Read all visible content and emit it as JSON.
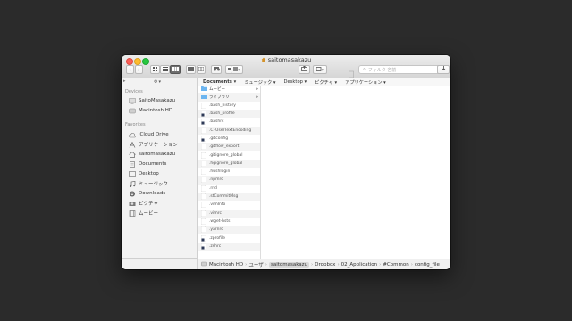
{
  "window": {
    "title": "saitomasakazu"
  },
  "toolbar": {
    "search_placeholder": "フィルタ 名前",
    "back_icon": "chevron-left-icon",
    "forward_icon": "chevron-right-icon"
  },
  "sidebar": {
    "devices_label": "Devices",
    "devices": [
      {
        "label": "SaitoMasakazu",
        "icon": "computer-icon"
      },
      {
        "label": "Macintosh HD",
        "icon": "disk-icon"
      }
    ],
    "favorites_label": "Favorites",
    "favorites": [
      {
        "label": "iCloud Drive",
        "icon": "cloud-icon"
      },
      {
        "label": "アプリケーション",
        "icon": "applications-icon"
      },
      {
        "label": "saitomasakazu",
        "icon": "home-icon"
      },
      {
        "label": "Documents",
        "icon": "documents-icon"
      },
      {
        "label": "Desktop",
        "icon": "desktop-icon"
      },
      {
        "label": "ミュージック",
        "icon": "music-icon"
      },
      {
        "label": "Downloads",
        "icon": "downloads-icon"
      },
      {
        "label": "ピクチャ",
        "icon": "pictures-icon"
      },
      {
        "label": "ムービー",
        "icon": "movies-icon"
      }
    ]
  },
  "column_header": [
    "Documents ▾",
    "ミュージック ▾",
    "Desktop ▾",
    "ピクチャ ▾",
    "アプリケーション ▾"
  ],
  "column1": [
    {
      "label": "ムービー",
      "type": "folder"
    },
    {
      "label": "ライブラリ",
      "type": "folder"
    },
    {
      "label": ".bash_history",
      "type": "file"
    },
    {
      "label": ".bash_profile",
      "type": "exec"
    },
    {
      "label": ".bashrc",
      "type": "exec"
    },
    {
      "label": ".CFUserTextEncoding",
      "type": "file"
    },
    {
      "label": ".gitconfig",
      "type": "exec"
    },
    {
      "label": ".gitflow_export",
      "type": "file"
    },
    {
      "label": ".gitignore_global",
      "type": "file"
    },
    {
      "label": ".hgignore_global",
      "type": "file"
    },
    {
      "label": ".hushlogin",
      "type": "file"
    },
    {
      "label": ".npmrc",
      "type": "file"
    },
    {
      "label": ".rnd",
      "type": "file"
    },
    {
      "label": ".stCommitMsg",
      "type": "file"
    },
    {
      "label": ".vimInfo",
      "type": "file"
    },
    {
      "label": ".vimrc",
      "type": "file"
    },
    {
      "label": ".wget-hsts",
      "type": "file"
    },
    {
      "label": ".yarnrc",
      "type": "file"
    },
    {
      "label": ".zprofile",
      "type": "exec"
    },
    {
      "label": ".zshrc",
      "type": "exec"
    }
  ],
  "pathbar": [
    {
      "label": "Macintosh HD"
    },
    {
      "label": "ユーザ"
    },
    {
      "label": "saitomasakazu",
      "current": true
    },
    {
      "label": "Dropbox"
    },
    {
      "label": "02_Application"
    },
    {
      "label": "#Common"
    },
    {
      "label": "config_file"
    }
  ],
  "colors": {
    "folder": "#6cb5f0",
    "accent": "#3d8ee0",
    "bg": "#2b2b2b"
  }
}
